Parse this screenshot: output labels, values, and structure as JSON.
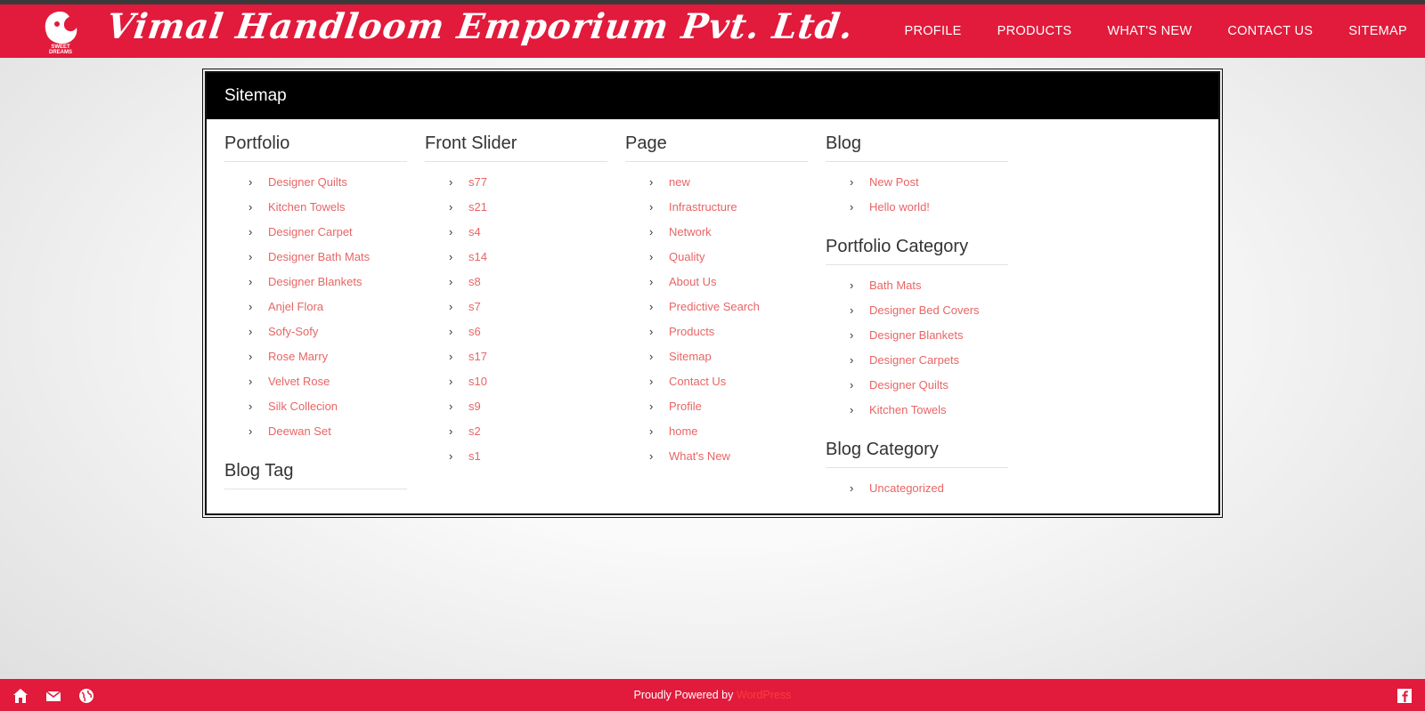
{
  "header": {
    "brand": "Vimal Handloom Emporium Pvt. Ltd.",
    "logo_text": "SWEET DREAMS",
    "nav": [
      "PROFILE",
      "PRODUCTS",
      "WHAT'S NEW",
      "CONTACT US",
      "SITEMAP"
    ]
  },
  "panel": {
    "title": "Sitemap",
    "portfolio": {
      "title": "Portfolio",
      "items": [
        "Designer Quilts",
        "Kitchen Towels",
        "Designer Carpet",
        "Designer Bath Mats",
        "Designer Blankets",
        "Anjel Flora",
        "Sofy-Sofy",
        "Rose Marry",
        "Velvet Rose",
        "Silk Collecion",
        "Deewan Set"
      ]
    },
    "blog_tag": {
      "title": "Blog Tag"
    },
    "front_slider": {
      "title": "Front Slider",
      "items": [
        "s77",
        "s21",
        "s4",
        "s14",
        "s8",
        "s7",
        "s6",
        "s17",
        "s10",
        "s9",
        "s2",
        "s1"
      ]
    },
    "page": {
      "title": "Page",
      "items": [
        "new",
        "Infrastructure",
        "Network",
        "Quality",
        "About Us",
        "Predictive Search",
        "Products",
        "Sitemap",
        "Contact Us",
        "Profile",
        "home",
        "What's New"
      ]
    },
    "blog": {
      "title": "Blog",
      "items": [
        "New Post",
        "Hello world!"
      ]
    },
    "portfolio_category": {
      "title": "Portfolio Category",
      "items": [
        "Bath Mats",
        "Designer Bed Covers",
        "Designer Blankets",
        "Designer Carpets",
        "Designer Quilts",
        "Kitchen Towels"
      ]
    },
    "blog_category": {
      "title": "Blog Category",
      "items": [
        "Uncategorized"
      ]
    }
  },
  "footer": {
    "powered_text": "Proudly Powered by",
    "powered_link": "WordPress"
  },
  "colors": {
    "brand_red": "#e21a3b",
    "link": "#e86565",
    "panel_header": "#000000"
  },
  "icons": [
    "home-icon",
    "mail-icon",
    "globe-icon",
    "facebook-icon",
    "chevron-right-icon"
  ]
}
